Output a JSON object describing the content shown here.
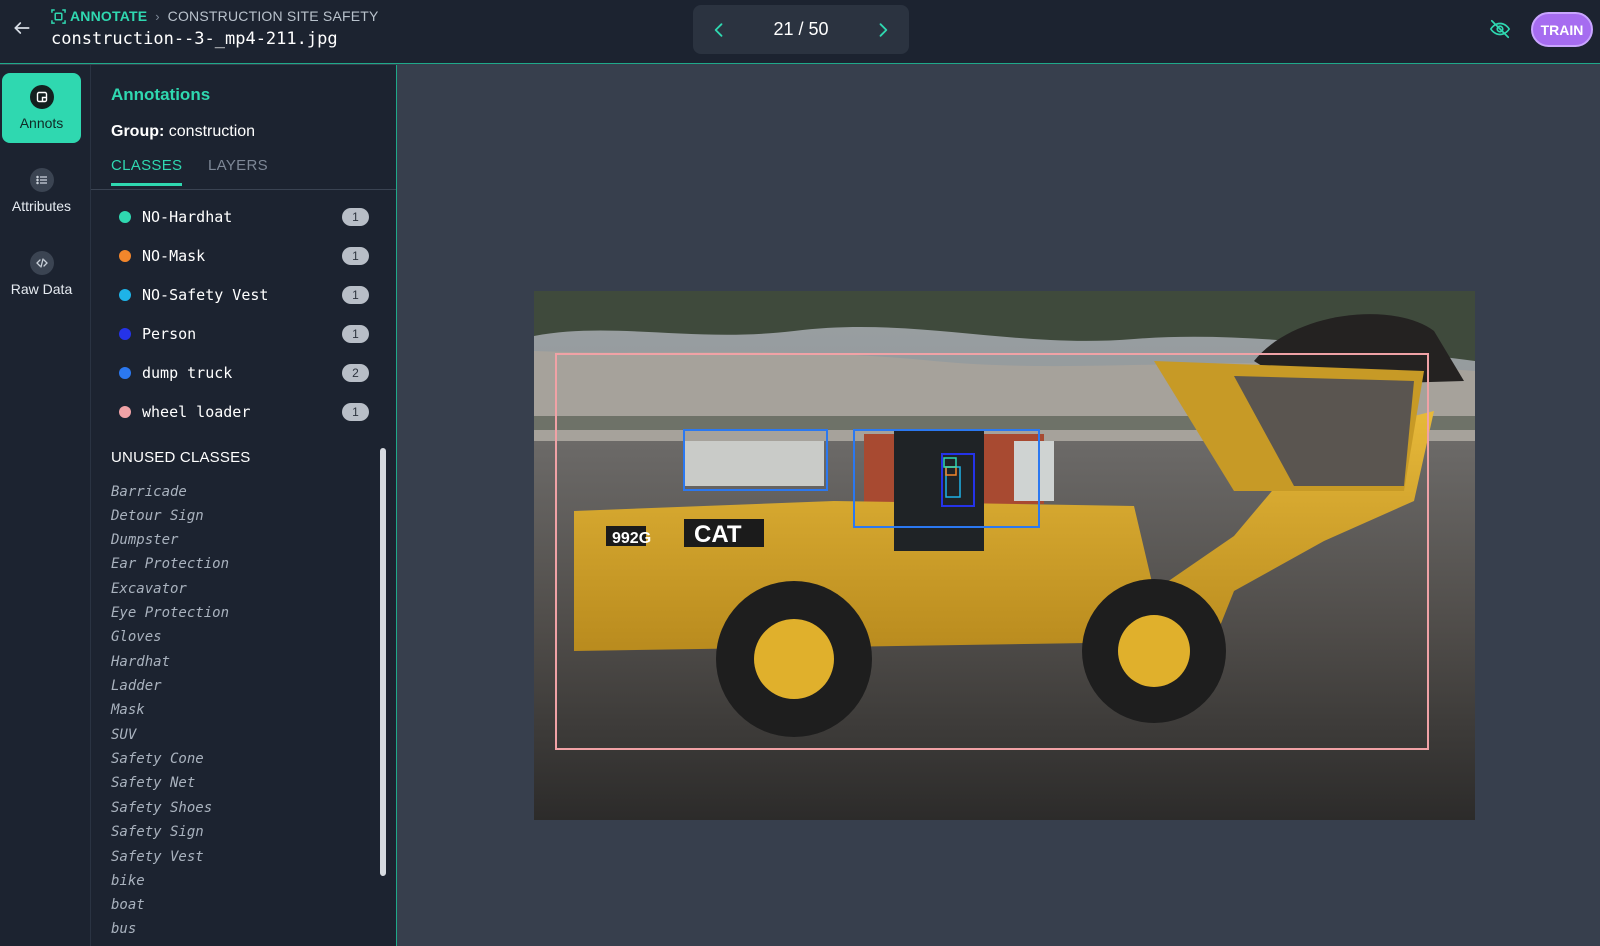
{
  "header": {
    "section": "ANNOTATE",
    "project": "CONSTRUCTION SITE SAFETY",
    "filename": "construction--3-_mp4-211.jpg",
    "pager_text": "21 / 50",
    "train_label": "TRAIN"
  },
  "rail": {
    "items": [
      {
        "label": "Annots"
      },
      {
        "label": "Attributes"
      },
      {
        "label": "Raw Data"
      }
    ]
  },
  "panel": {
    "title": "Annotations",
    "group_label": "Group:",
    "group_value": "construction",
    "tabs": [
      {
        "label": "CLASSES"
      },
      {
        "label": "LAYERS"
      }
    ],
    "classes": [
      {
        "name": "NO-Hardhat",
        "count": "1",
        "color": "#2fd8b0"
      },
      {
        "name": "NO-Mask",
        "count": "1",
        "color": "#f2862b"
      },
      {
        "name": "NO-Safety Vest",
        "count": "1",
        "color": "#1eb3e8"
      },
      {
        "name": "Person",
        "count": "1",
        "color": "#2533e8"
      },
      {
        "name": "dump truck",
        "count": "2",
        "color": "#2b78f0"
      },
      {
        "name": "wheel loader",
        "count": "1",
        "color": "#f0a2a6"
      }
    ],
    "unused_title": "UNUSED CLASSES",
    "unused_classes": [
      "Barricade",
      "Detour Sign",
      "Dumpster",
      "Ear Protection",
      "Excavator",
      "Eye Protection",
      "Gloves",
      "Hardhat",
      "Ladder",
      "Mask",
      "SUV",
      "Safety Cone",
      "Safety Net",
      "Safety Shoes",
      "Safety Sign",
      "Safety Vest",
      "bike",
      "boat",
      "bus"
    ]
  },
  "image": {
    "decal_model": "992G",
    "decal_brand": "CAT"
  },
  "colors": {
    "accent": "#2fd8b0",
    "train": "#a66cf0",
    "background": "#373f4d",
    "panel": "#1c2330"
  }
}
